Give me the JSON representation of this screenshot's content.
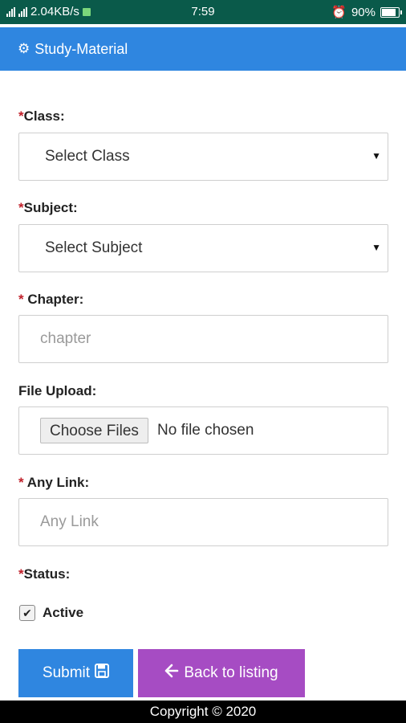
{
  "status_bar": {
    "network_speed": "2.04KB/s",
    "time": "7:59",
    "battery": "90%",
    "battery_level": 0.9,
    "icons": [
      "signal-icon",
      "sim-icon",
      "alarm-icon",
      "battery-icon"
    ]
  },
  "header": {
    "title": "Study-Material",
    "icon": "gear-icon",
    "color": "#2f86e0"
  },
  "form": {
    "class": {
      "label": "Class:",
      "required_mark": "*",
      "value": "Select Class"
    },
    "subject": {
      "label": "Subject:",
      "required_mark": "*",
      "value": "Select Subject"
    },
    "chapter": {
      "label": " Chapter:",
      "required_mark": "*",
      "placeholder": "chapter"
    },
    "file_upload": {
      "label": "File Upload:",
      "button": "Choose Files",
      "status": "No file chosen"
    },
    "any_link": {
      "label": " Any Link:",
      "required_mark": "*",
      "placeholder": "Any Link"
    },
    "status": {
      "label": "Status:",
      "required_mark": "*",
      "checkbox_label": "Active",
      "checked": true
    }
  },
  "buttons": {
    "submit": {
      "label": "Submit",
      "icon": "save-icon",
      "color": "#2f86e0"
    },
    "back": {
      "label": "Back to listing",
      "icon": "arrow-left-icon",
      "color": "#a64cc3"
    }
  },
  "footer": {
    "text": "Copyright © 2020"
  }
}
